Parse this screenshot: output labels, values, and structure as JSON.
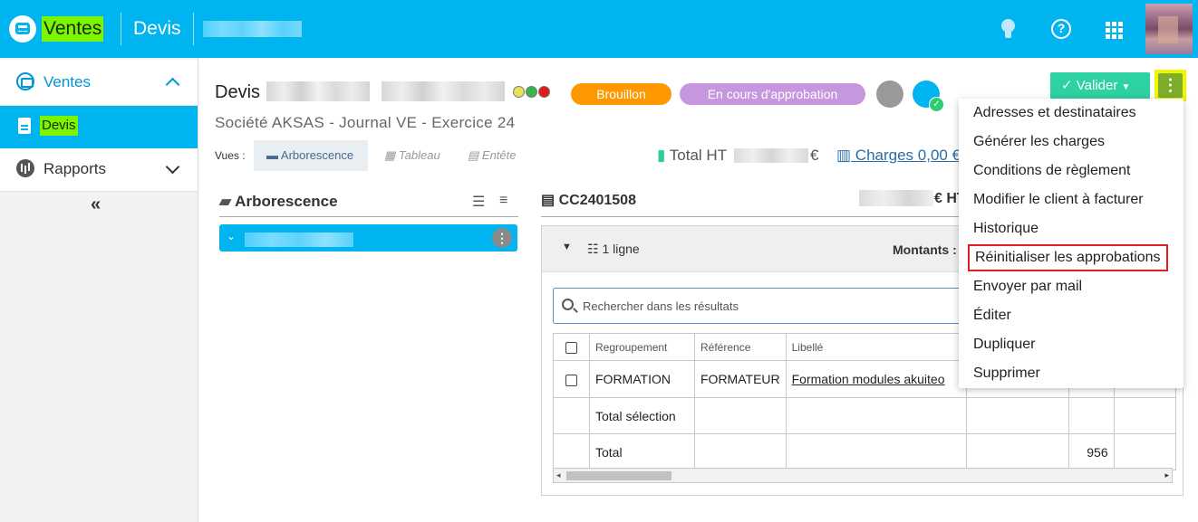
{
  "header": {
    "app_name": "Ventes",
    "module_name": "Devis"
  },
  "sidebar": {
    "items": [
      {
        "label": "Ventes"
      },
      {
        "label": "Devis"
      },
      {
        "label": "Rapports"
      }
    ],
    "collapse_glyph": "«"
  },
  "document": {
    "title_prefix": "Devis",
    "status_badges": [
      "Brouillon",
      "En cours d'approbation"
    ],
    "subtitle": "Société AKSAS  -  Journal VE  -  Exercice 24",
    "views_label": "Vues :",
    "views": [
      "Arborescence",
      "Tableau",
      "Entête"
    ],
    "total_ht_label": "Total HT",
    "currency": "€",
    "charges_label": "Charges 0,00 €",
    "validate_label": "Valider"
  },
  "tree": {
    "title": "Arborescence"
  },
  "main": {
    "doc_code": "CC2401508",
    "ht_suffix": "€ HT",
    "lines_label": "1 ligne",
    "montants_label": "Montants :",
    "search_placeholder": "Rechercher dans les résultats",
    "table": {
      "headers": [
        "Regroupement",
        "Référence",
        "Libellé"
      ],
      "row": {
        "regroupement": "FORMATION",
        "reference": "FORMATEUR",
        "libelle": "Formation modules akuiteo"
      },
      "total_selection": "Total sélection",
      "total": "Total",
      "total_partial_value": "956"
    }
  },
  "dropdown": {
    "items": [
      "Adresses et destinataires",
      "Générer les charges",
      "Conditions de règlement",
      "Modifier le client à facturer",
      "Historique",
      "Réinitialiser les approbations",
      "Envoyer par mail",
      "Éditer",
      "Dupliquer",
      "Supprimer"
    ]
  },
  "colors": {
    "topbar": "#00b4f0",
    "highlight_green": "#7cf500",
    "badge_orange": "#ff9800",
    "badge_purple": "#c696de",
    "validate_green": "#2ed1a2",
    "menu_highlight_border": "#e02020"
  },
  "icons": [
    "briefcase-icon",
    "lightbulb-icon",
    "help-icon",
    "apps-grid-icon",
    "document-icon",
    "chart-icon",
    "folder-open-icon",
    "list-icon",
    "euro-file-icon",
    "bar-chart-icon",
    "search-icon",
    "kebab-icon"
  ]
}
